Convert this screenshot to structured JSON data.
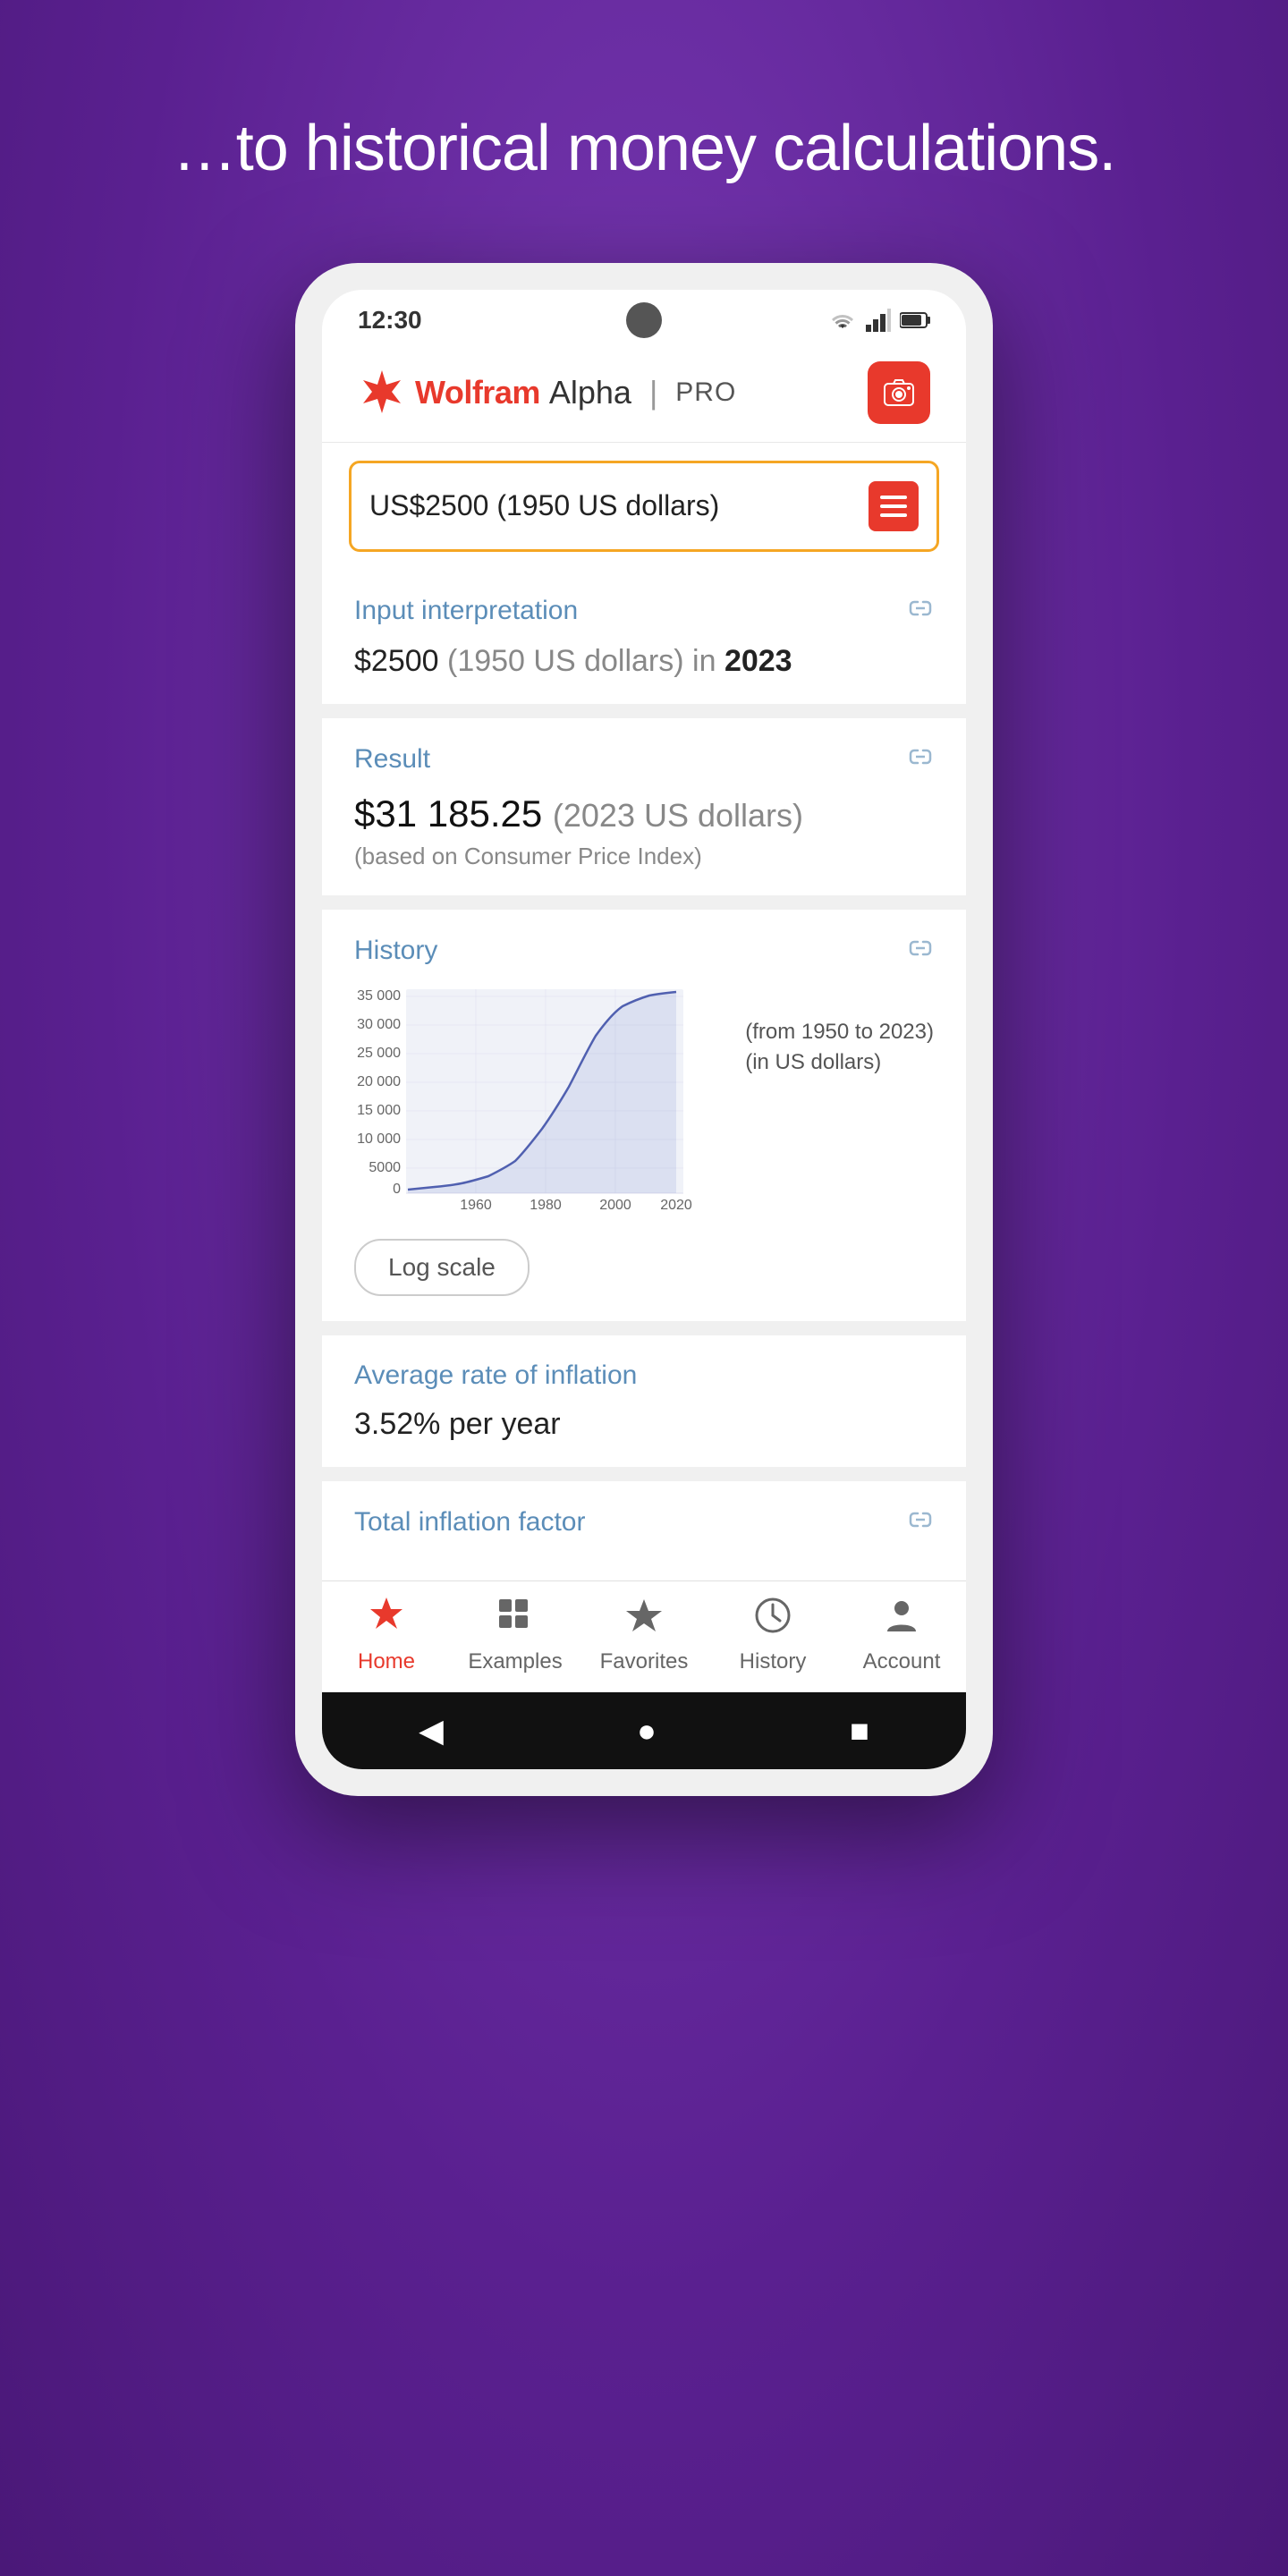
{
  "hero": {
    "text": "…to historical money calculations."
  },
  "status_bar": {
    "time": "12:30",
    "wifi": "▼",
    "signal": "▲",
    "battery": "🔋"
  },
  "app_header": {
    "logo_wolfram": "Wolfram",
    "logo_alpha": "Alpha",
    "logo_divider": "|",
    "logo_pro": "PRO",
    "camera_icon": "📷"
  },
  "search": {
    "input_value": "US$2500 (1950 US dollars)",
    "menu_icon": "☰"
  },
  "input_interpretation": {
    "title": "Input interpretation",
    "text_dollar": "$2500",
    "text_parens": "(1950 US dollars) in",
    "text_year": "2023"
  },
  "result": {
    "title": "Result",
    "value": "$31 185.25",
    "value_parens": "(2023 US dollars)",
    "note": "(based on Consumer Price Index)"
  },
  "history_section": {
    "title": "History",
    "chart_from": "(from 1950 to 2023)",
    "chart_in": "(in US dollars)",
    "y_labels": [
      "35 000",
      "30 000",
      "25 000",
      "20 000",
      "15 000",
      "10 000",
      "5000",
      "0"
    ],
    "x_labels": [
      "1960",
      "1980",
      "2000",
      "2020"
    ],
    "log_scale_button": "Log scale"
  },
  "average_inflation": {
    "title": "Average rate of inflation",
    "value": "3.52% per year"
  },
  "total_inflation": {
    "title": "Total inflation factor"
  },
  "bottom_nav": {
    "items": [
      {
        "id": "home",
        "label": "Home",
        "icon": "✦",
        "active": true
      },
      {
        "id": "examples",
        "label": "Examples",
        "icon": "⊞",
        "active": false
      },
      {
        "id": "favorites",
        "label": "Favorites",
        "icon": "★",
        "active": false
      },
      {
        "id": "history",
        "label": "History",
        "icon": "🕐",
        "active": false
      },
      {
        "id": "account",
        "label": "Account",
        "icon": "👤",
        "active": false
      }
    ]
  },
  "android_nav": {
    "back": "◀",
    "home": "●",
    "recent": "■"
  }
}
